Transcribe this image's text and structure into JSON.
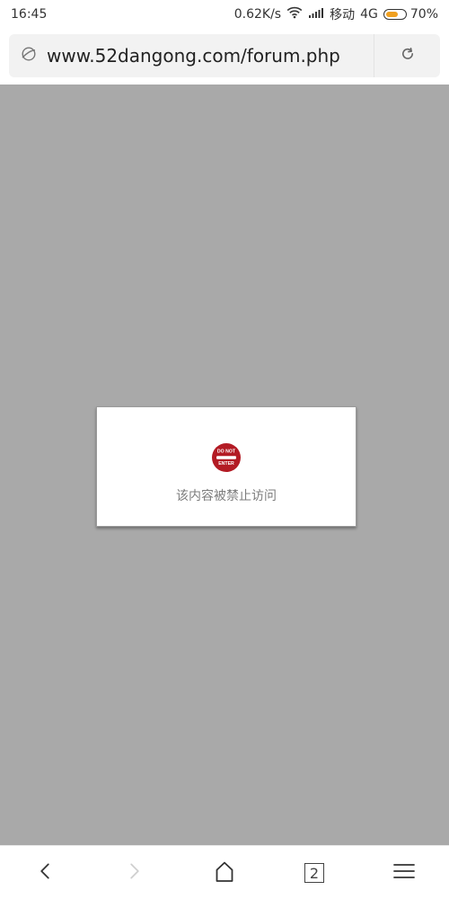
{
  "status_bar": {
    "time": "16:45",
    "network_speed": "0.62K/s",
    "carrier": "移动",
    "network_type": "4G",
    "battery_percent": "70%",
    "battery_level": 0.7,
    "colors": {
      "battery_fill": "#f0a020"
    }
  },
  "address_bar": {
    "url": "www.52dangong.com/forum.php",
    "left_icon": "planet-icon",
    "right_icon": "refresh-icon"
  },
  "content": {
    "background": "#a9a9a9",
    "blocked_card": {
      "icon": "do-not-enter-icon",
      "icon_text_top": "DO NOT",
      "icon_text_bottom": "ENTER",
      "message": "该内容被禁止访问",
      "icon_color": "#b31b24"
    }
  },
  "bottom_bar": {
    "back_icon": "chevron-left-icon",
    "forward_icon": "chevron-right-icon",
    "home_icon": "home-icon",
    "tabs_count": "2",
    "menu_icon": "menu-icon"
  }
}
